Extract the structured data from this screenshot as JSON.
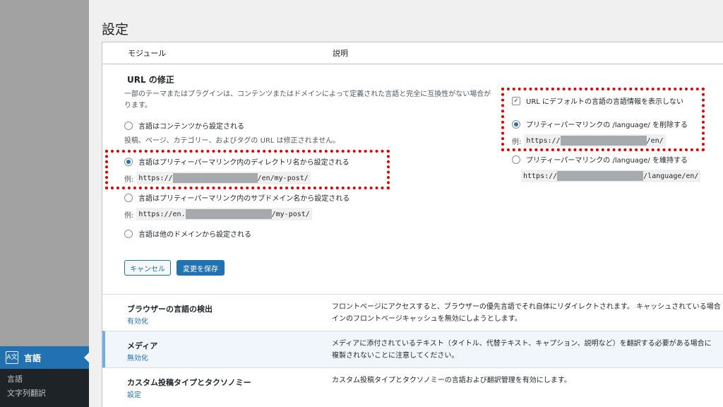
{
  "page": {
    "title": "設定"
  },
  "sidebar": {
    "active": {
      "label": "言語",
      "icon": "translation-icon"
    },
    "submenu": [
      "言語",
      "文字列翻訳"
    ]
  },
  "table": {
    "col_module": "モジュール",
    "col_description": "説明"
  },
  "url_section": {
    "title": "URL の修正",
    "description_line1": "一部のテーマまたはプラグインは、コンテンツまたはドメインによって定義された言語と完全に互換性がない場合が",
    "description_line2": "ります。",
    "option_content": "言語はコンテンツから設定される",
    "content_note": "投稿、ページ、カテゴリー、およびタグの URL は修正されません。",
    "option_directory": "言語はプリティーパーマリンク内のディレクトリ名から設定される",
    "example_label": "例:",
    "dir_example_prefix": "https://",
    "dir_example_suffix": "/en/my-post/",
    "option_subdomain": "言語はプリティーパーマリンク内のサブドメイン名から設定される",
    "sub_example_prefix": "https://en.",
    "sub_example_suffix": "/my-post/",
    "option_domain": "言語は他のドメインから設定される",
    "hide_default": "URL にデフォルトの言語の言語情報を表示しない",
    "remove_language": "プリティーパーマリンクの /language/ を削除する",
    "remove_example_prefix": "https://",
    "remove_example_suffix": "/en/",
    "keep_language": "プリティーパーマリンクの /language/ を維持する",
    "keep_example_prefix": "https://",
    "keep_example_suffix": "/language/en/",
    "cancel": "キャンセル",
    "save": "変更を保存"
  },
  "modules": [
    {
      "name": "ブラウザーの言語の検出",
      "action": "有効化",
      "desc1": "フロントページにアクセスすると、ブラウザーの優先言語でそれ自体にリダイレクトされます。 キャッシュされている場合",
      "desc2": "インのフロントページキャッシュを無効にしようとします。"
    },
    {
      "name": "メディア",
      "action": "無効化",
      "desc1": "メディアに添付されているテキスト（タイトル、代替テキスト、キャプション、説明など）を翻訳する必要がある場合に",
      "desc2": "複製されないことに注意してください。"
    },
    {
      "name": "カスタム投稿タイプとタクソノミー",
      "action": "設定",
      "desc1": "カスタム投稿タイプとタクソノミーの言語および翻訳管理を有効にします。",
      "desc2": ""
    }
  ],
  "colors": {
    "accent": "#2271b1",
    "highlight": "#e00000",
    "menu_bg": "#1d2327"
  }
}
